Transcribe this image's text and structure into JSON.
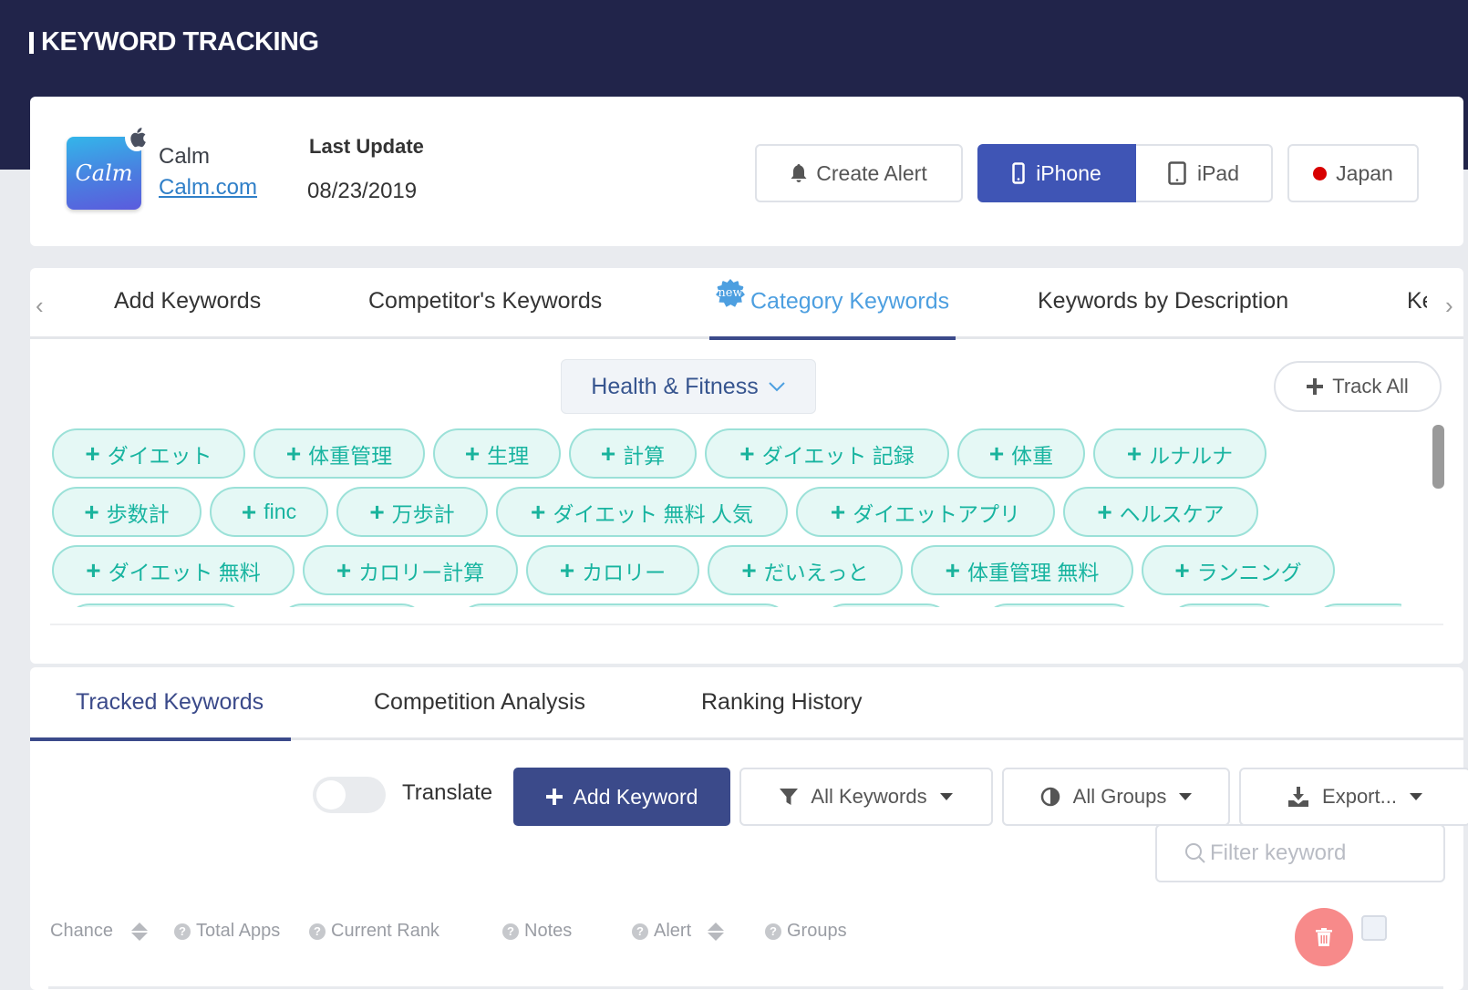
{
  "header": {
    "title": "KEYWORD TRACKING"
  },
  "app": {
    "name": "Calm",
    "icon_text": "Calm",
    "developer_link": "Calm.com",
    "platform_icon": "apple-icon",
    "last_update_label": "Last Update",
    "last_update_value": "08/23/2019"
  },
  "toolbar": {
    "create_alert": "Create Alert",
    "devices": [
      {
        "label": "iPhone",
        "icon": "iphone-icon",
        "active": true
      },
      {
        "label": "iPad",
        "icon": "ipad-icon",
        "active": false
      }
    ],
    "country": "Japan",
    "country_color": "#d80000"
  },
  "keyword_tabs": {
    "items": [
      {
        "label": "Add Keywords"
      },
      {
        "label": "Competitor's Keywords"
      },
      {
        "label": "Category Keywords",
        "badge": "new",
        "active": true
      },
      {
        "label": "Keywords by Description"
      },
      {
        "label": "Ke"
      }
    ]
  },
  "category": {
    "selected": "Health & Fitness",
    "track_all": "Track All",
    "rows": [
      [
        "ダイエット",
        "体重管理",
        "生理",
        "計算",
        "ダイエット 記録",
        "体重",
        "ルナルナ"
      ],
      [
        "歩数計",
        "finc",
        "万歩計",
        "ダイエット 無料 人気",
        "ダイエットアプリ",
        "ヘルスケア"
      ],
      [
        "ダイエット 無料",
        "カロリー計算",
        "カロリー",
        "だいえっと",
        "体重管理 無料",
        "ランニング"
      ]
    ]
  },
  "tracked": {
    "tabs": [
      {
        "label": "Tracked Keywords",
        "active": true
      },
      {
        "label": "Competition Analysis"
      },
      {
        "label": "Ranking History"
      }
    ],
    "translate_label": "Translate",
    "translate_on": false,
    "add_keyword": "Add Keyword",
    "all_keywords": "All Keywords",
    "all_groups": "All Groups",
    "export": "Export...",
    "filter_placeholder": "Filter keyword",
    "columns": {
      "chance": "Chance",
      "total_apps": "Total Apps",
      "current_rank": "Current Rank",
      "notes": "Notes",
      "alert": "Alert",
      "groups": "Groups"
    }
  },
  "colors": {
    "header_bg": "#21244a",
    "primary": "#3b4a8a",
    "device_active": "#3f55b5",
    "accent_blue": "#4d9fe0",
    "chip_text": "#18b4a0",
    "chip_bg": "#e5f8f5",
    "delete": "#f78a8a"
  }
}
